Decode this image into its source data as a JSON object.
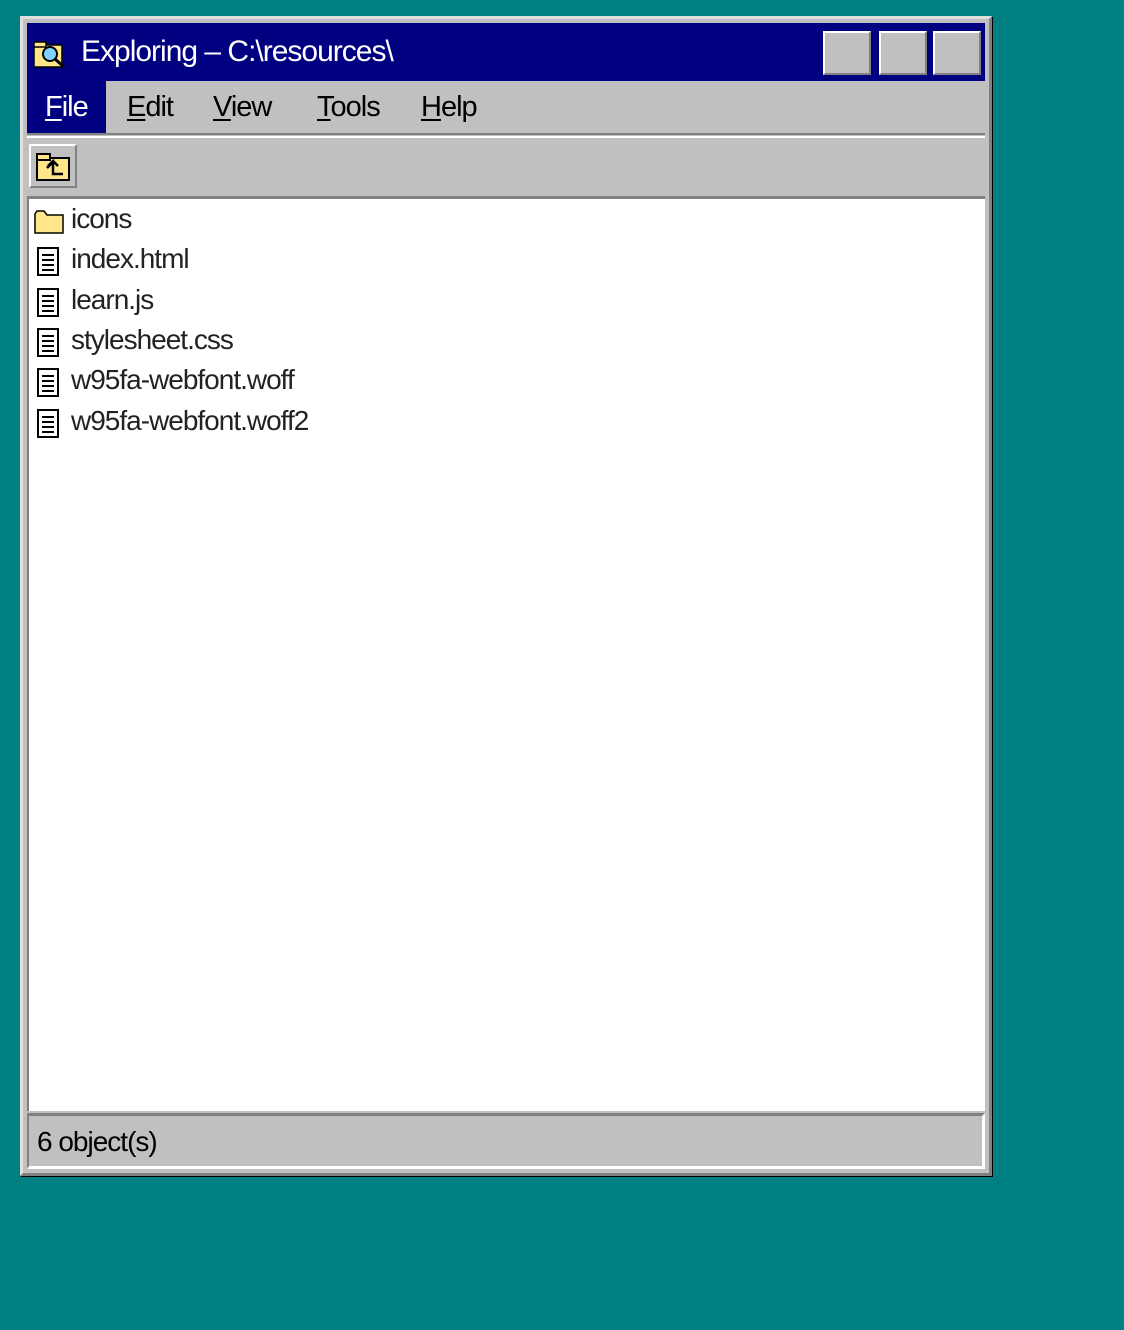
{
  "window": {
    "title": "Exploring – C:\\resources\\",
    "title_icon": "explorer-icon"
  },
  "menu": [
    {
      "label": "File",
      "accel": "F",
      "rest": "ile",
      "active": true
    },
    {
      "label": "Edit",
      "accel": "E",
      "rest": "dit",
      "active": false
    },
    {
      "label": "View",
      "accel": "V",
      "rest": "iew",
      "active": false
    },
    {
      "label": "Tools",
      "accel": "T",
      "rest": "ools",
      "active": false
    },
    {
      "label": "Help",
      "accel": "H",
      "rest": "elp",
      "active": false
    }
  ],
  "toolbar": {
    "up_icon": "up-folder-icon"
  },
  "files": [
    {
      "name": "icons",
      "icon": "folder-icon"
    },
    {
      "name": "index.html",
      "icon": "document-icon"
    },
    {
      "name": "learn.js",
      "icon": "document-icon"
    },
    {
      "name": "stylesheet.css",
      "icon": "document-icon"
    },
    {
      "name": "w95fa-webfont.woff",
      "icon": "document-icon"
    },
    {
      "name": "w95fa-webfont.woff2",
      "icon": "document-icon"
    }
  ],
  "status": {
    "text": "6 object(s)"
  },
  "colors": {
    "desktop": "#008080",
    "titlebar": "#000080",
    "face": "#c0c0c0",
    "folder": "#ffe68a"
  }
}
